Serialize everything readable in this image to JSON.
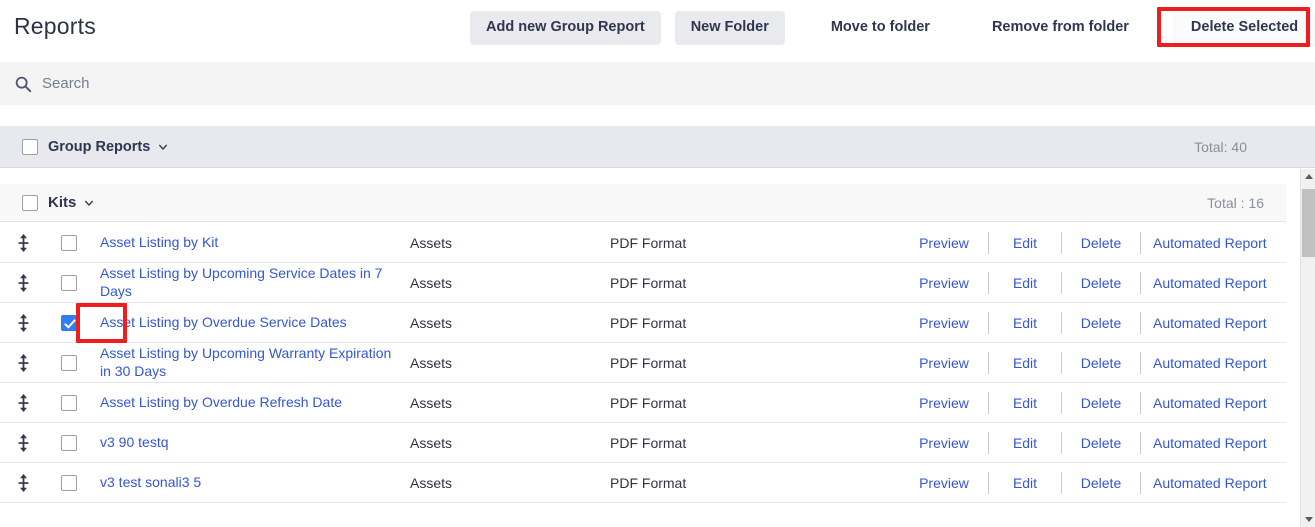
{
  "header": {
    "title": "Reports",
    "actions": [
      {
        "label": "Add new Group Report",
        "style": "filled"
      },
      {
        "label": "New Folder",
        "style": "filled"
      },
      {
        "label": "Move to folder",
        "style": "plain"
      },
      {
        "label": "Remove from folder",
        "style": "plain"
      },
      {
        "label": "Delete Selected",
        "style": "boxed",
        "highlighted": true
      }
    ]
  },
  "search": {
    "placeholder": "Search",
    "value": "",
    "icon": "search-icon"
  },
  "group_band": {
    "label": "Group Reports",
    "total": "Total: 40",
    "checked": false,
    "caret": "chevron-down-icon"
  },
  "section": {
    "label": "Kits",
    "total": "Total : 16",
    "checked": false,
    "caret": "chevron-down-icon"
  },
  "columns": {
    "type": "Assets",
    "format": "PDF Format"
  },
  "row_actions": {
    "preview": "Preview",
    "edit": "Edit",
    "delete": "Delete",
    "automated": "Automated Report"
  },
  "rows": [
    {
      "name": "Asset Listing by Kit",
      "type": "Assets",
      "format": "PDF Format",
      "checked": false
    },
    {
      "name": "Asset Listing by Upcoming Service Dates in 7 Days",
      "type": "Assets",
      "format": "PDF Format",
      "checked": false
    },
    {
      "name": "Asset Listing by Overdue Service Dates",
      "type": "Assets",
      "format": "PDF Format",
      "checked": true
    },
    {
      "name": "Asset Listing by Upcoming Warranty Expiration in 30 Days",
      "type": "Assets",
      "format": "PDF Format",
      "checked": false
    },
    {
      "name": "Asset Listing by Overdue Refresh Date",
      "type": "Assets",
      "format": "PDF Format",
      "checked": false
    },
    {
      "name": "v3 90 testq",
      "type": "Assets",
      "format": "PDF Format",
      "checked": false
    },
    {
      "name": "v3 test sonali3 5",
      "type": "Assets",
      "format": "PDF Format",
      "checked": false
    }
  ],
  "scrollbar": {
    "up_icon": "scroll-up-arrow-icon",
    "down_icon": "scroll-down-arrow-icon"
  },
  "annotations": {
    "color": "#ef1d1d",
    "items": [
      {
        "target": "delete-selected-button"
      },
      {
        "target": "row-checkbox-overdue-service-dates"
      }
    ]
  }
}
